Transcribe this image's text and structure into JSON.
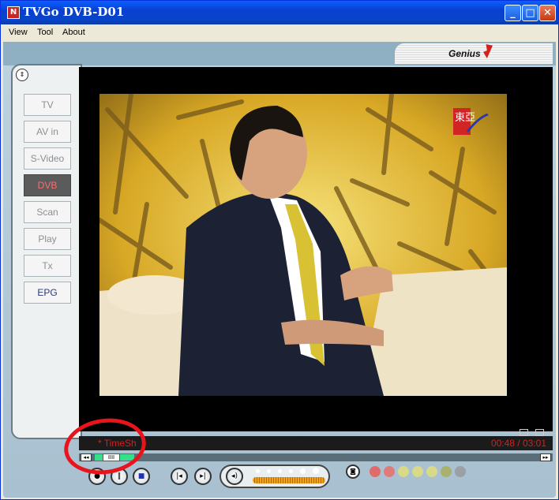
{
  "window": {
    "title": "TVGo DVB-D01",
    "app_icon_glyph": "N",
    "controls": {
      "minimize": "_",
      "maximize": "□",
      "close": "✕"
    }
  },
  "menu": {
    "items": [
      "View",
      "Tool",
      "About"
    ]
  },
  "brand": {
    "logo_text": "Genius",
    "swoosh_color": "#d61f1f"
  },
  "sidebar": {
    "collapse_icon": "⇕",
    "sources": [
      "TV",
      "AV in",
      "S-Video",
      "DVB",
      "Scan",
      "Play",
      "Tx",
      "EPG"
    ],
    "active": "DVB"
  },
  "video": {
    "channel_logo_text": "東亞"
  },
  "status": {
    "timeshift_label": "* TimeSh",
    "time": "00:48 / 03:01"
  },
  "timeline": {
    "rewind_glyph": "◂◂",
    "forward_glyph": "▸▸",
    "thumb_glyph": "IIII",
    "fill_fraction": 0.09
  },
  "controls": {
    "record_glyph": "●",
    "pause_glyph": "‖",
    "stop_glyph": "■",
    "prev_glyph": "|◂",
    "next_glyph": "▸|",
    "mute_glyph": "◂)",
    "camera_glyph": "◙",
    "volume_level": 0.85
  },
  "colors": {
    "accent_red": "#d32020",
    "timeline_fill": "#36e08a",
    "active_source_text": "#ff6b6b"
  }
}
